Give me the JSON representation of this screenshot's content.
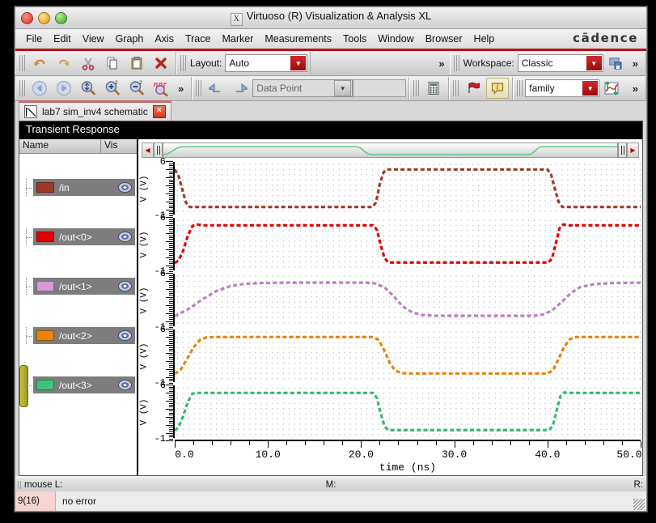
{
  "window": {
    "title": "Virtuoso (R) Visualization & Analysis XL",
    "buttons": {
      "close": "close-button",
      "minimize": "minimize-button",
      "maximize": "maximize-button"
    }
  },
  "menubar": {
    "items": [
      "File",
      "Edit",
      "View",
      "Graph",
      "Axis",
      "Trace",
      "Marker",
      "Measurements",
      "Tools",
      "Window",
      "Browser",
      "Help"
    ],
    "brand": "cādence"
  },
  "toolbar1": {
    "icons": [
      "undo-icon",
      "redo-icon",
      "cut-icon",
      "copy-icon",
      "paste-icon",
      "delete-icon"
    ],
    "layout_label": "Layout:",
    "layout_value": "Auto",
    "overflow": "»",
    "workspace_label": "Workspace:",
    "workspace_value": "Classic",
    "save_workspace_icon": "save-workspace-icon",
    "overflow2": "»"
  },
  "toolbar2": {
    "icons": [
      "back-icon",
      "forward-icon",
      "zoom-fit-icon",
      "zoom-in-icon",
      "zoom-out-icon",
      "zoom-waveform-icon"
    ],
    "overflow": "»",
    "nav_icons": [
      "prev-datapoint-icon",
      "next-datapoint-icon"
    ],
    "mode_value": "Data Point",
    "field_value": "",
    "calculator_icon": "calculator-icon",
    "flag_icon": "flag-icon",
    "info_icon": "info-icon",
    "family_value": "family",
    "swap_icon": "swap-axes-icon",
    "overflow2": "»"
  },
  "tab": {
    "label": "lab7 sim_inv4 schematic",
    "close": "×"
  },
  "graph": {
    "title": "Transient Response",
    "sidebar": {
      "col_name": "Name",
      "col_vis": "Vis"
    }
  },
  "chart_data": {
    "type": "line",
    "title": "Transient Response",
    "xlabel": "time (ns)",
    "ylabel": "V (V)",
    "xlim": [
      0.0,
      50.0
    ],
    "xticks": [
      "0.0",
      "10.0",
      "20.0",
      "30.0",
      "40.0",
      "50.0"
    ],
    "ylim": [
      -1,
      6
    ],
    "yticks_top": "6",
    "yticks_bottom": "-1",
    "grid": true,
    "legend": "sidebar",
    "series": [
      {
        "name": "/in",
        "color": "#a03828",
        "low": 0.0,
        "high": 5.0,
        "points": [
          [
            0,
            5.0
          ],
          [
            0.4,
            4.2
          ],
          [
            0.8,
            2.4
          ],
          [
            1.2,
            0.6
          ],
          [
            1.6,
            0.0
          ],
          [
            21.2,
            0.0
          ],
          [
            21.6,
            0.6
          ],
          [
            22.0,
            3.0
          ],
          [
            22.4,
            4.6
          ],
          [
            22.8,
            5.0
          ],
          [
            40.0,
            5.0
          ],
          [
            40.4,
            4.3
          ],
          [
            40.8,
            2.4
          ],
          [
            41.2,
            0.7
          ],
          [
            41.6,
            0.0
          ],
          [
            50,
            0.0
          ]
        ]
      },
      {
        "name": "/out<0>",
        "color": "#e00000",
        "low": 0.0,
        "high": 5.0,
        "points": [
          [
            0,
            0.0
          ],
          [
            0.4,
            0.3
          ],
          [
            0.9,
            1.6
          ],
          [
            1.4,
            3.6
          ],
          [
            1.9,
            4.9
          ],
          [
            2.4,
            5.1
          ],
          [
            3.0,
            5.0
          ],
          [
            21.3,
            5.0
          ],
          [
            21.7,
            4.4
          ],
          [
            22.1,
            2.4
          ],
          [
            22.5,
            0.7
          ],
          [
            22.9,
            0.05
          ],
          [
            40.1,
            0.05
          ],
          [
            40.5,
            0.6
          ],
          [
            40.9,
            2.6
          ],
          [
            41.3,
            4.6
          ],
          [
            41.7,
            5.1
          ],
          [
            42.3,
            5.0
          ],
          [
            50,
            5.0
          ]
        ]
      },
      {
        "name": "/out<1>",
        "color": "#bd7fc4",
        "low": 0.35,
        "high": 4.75,
        "points": [
          [
            0,
            0.35
          ],
          [
            1.5,
            1.3
          ],
          [
            3,
            2.6
          ],
          [
            4.5,
            3.7
          ],
          [
            6,
            4.35
          ],
          [
            7.5,
            4.65
          ],
          [
            9,
            4.75
          ],
          [
            12,
            4.8
          ],
          [
            20.5,
            4.8
          ],
          [
            21.5,
            4.7
          ],
          [
            22.5,
            4.2
          ],
          [
            23.5,
            3.0
          ],
          [
            24.5,
            1.6
          ],
          [
            25.5,
            0.85
          ],
          [
            26.5,
            0.5
          ],
          [
            28,
            0.4
          ],
          [
            38.5,
            0.4
          ],
          [
            39.5,
            0.55
          ],
          [
            40.5,
            1.1
          ],
          [
            41.5,
            2.2
          ],
          [
            42.5,
            3.4
          ],
          [
            43.5,
            4.2
          ],
          [
            45,
            4.6
          ],
          [
            47,
            4.75
          ],
          [
            50,
            4.8
          ]
        ]
      },
      {
        "name": "/out<2>",
        "color": "#e8820c",
        "low": 0.1,
        "high": 5.0,
        "points": [
          [
            0,
            0.1
          ],
          [
            0.6,
            0.6
          ],
          [
            1.3,
            2.0
          ],
          [
            2.0,
            3.6
          ],
          [
            2.7,
            4.6
          ],
          [
            3.4,
            4.95
          ],
          [
            4.2,
            5.0
          ],
          [
            21.3,
            5.0
          ],
          [
            21.9,
            4.6
          ],
          [
            22.5,
            3.2
          ],
          [
            23.1,
            1.5
          ],
          [
            23.7,
            0.5
          ],
          [
            24.4,
            0.2
          ],
          [
            25.2,
            0.15
          ],
          [
            40.0,
            0.15
          ],
          [
            40.6,
            0.6
          ],
          [
            41.2,
            2.1
          ],
          [
            41.8,
            3.7
          ],
          [
            42.4,
            4.7
          ],
          [
            43.1,
            5.0
          ],
          [
            44,
            5.0
          ],
          [
            50,
            5.0
          ]
        ]
      },
      {
        "name": "/out<3>",
        "color": "#2fbb6e",
        "low": 0.0,
        "high": 5.0,
        "points": [
          [
            0,
            0.0
          ],
          [
            0.4,
            0.4
          ],
          [
            0.9,
            1.9
          ],
          [
            1.4,
            3.8
          ],
          [
            1.9,
            4.9
          ],
          [
            2.5,
            5.0
          ],
          [
            3.2,
            5.0
          ],
          [
            21.3,
            5.0
          ],
          [
            21.7,
            4.3
          ],
          [
            22.1,
            2.3
          ],
          [
            22.5,
            0.6
          ],
          [
            22.9,
            0.05
          ],
          [
            40.2,
            0.05
          ],
          [
            40.6,
            0.7
          ],
          [
            41.0,
            2.7
          ],
          [
            41.4,
            4.6
          ],
          [
            41.8,
            5.05
          ],
          [
            42.4,
            5.0
          ],
          [
            50,
            5.0
          ]
        ]
      }
    ]
  },
  "signals": [
    {
      "name": "/in",
      "color": "#a03828",
      "vis": "visible-eye-icon",
      "selected": false
    },
    {
      "name": "/out<0>",
      "color": "#e00000",
      "vis": "visible-eye-icon",
      "selected": false
    },
    {
      "name": "/out<1>",
      "color": "#d69ad6",
      "vis": "visible-eye-icon",
      "selected": false
    },
    {
      "name": "/out<2>",
      "color": "#e8820c",
      "vis": "visible-eye-icon",
      "selected": false
    },
    {
      "name": "/out<3>",
      "color": "#3cc47c",
      "vis": "visible-eye-icon",
      "selected": true
    }
  ],
  "statusbar": {
    "mouse": "mouse L:",
    "middle": "M:",
    "right": "R:"
  },
  "errorbar": {
    "count": "9(16)",
    "message": "no error"
  }
}
